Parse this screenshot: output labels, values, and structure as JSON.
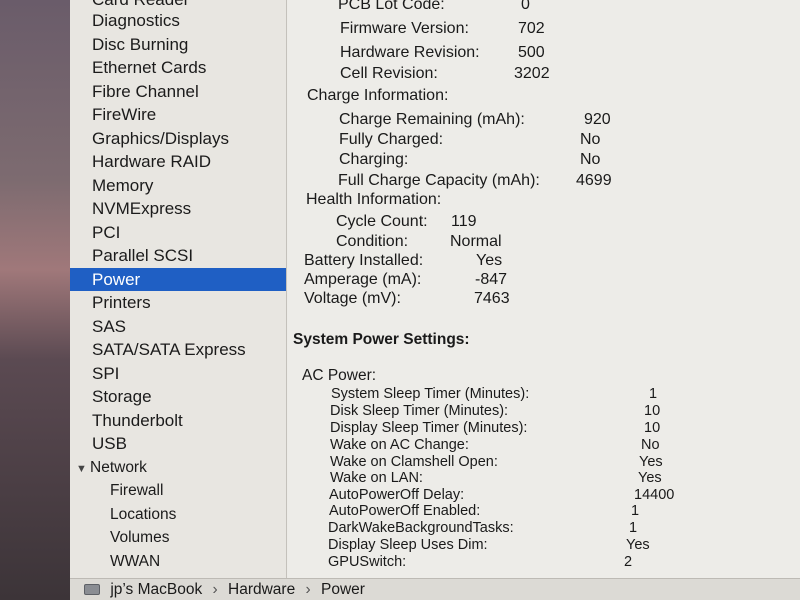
{
  "sidebar": {
    "top_partial": "Card Reader",
    "items": [
      {
        "label": "Diagnostics"
      },
      {
        "label": "Disc Burning"
      },
      {
        "label": "Ethernet Cards"
      },
      {
        "label": "Fibre Channel"
      },
      {
        "label": "FireWire"
      },
      {
        "label": "Graphics/Displays"
      },
      {
        "label": "Hardware RAID"
      },
      {
        "label": "Memory"
      },
      {
        "label": "NVMExpress"
      },
      {
        "label": "PCI"
      },
      {
        "label": "Parallel SCSI"
      },
      {
        "label": "Power",
        "selected": true
      },
      {
        "label": "Printers"
      },
      {
        "label": "SAS"
      },
      {
        "label": "SATA/SATA Express"
      },
      {
        "label": "SPI"
      },
      {
        "label": "Storage"
      },
      {
        "label": "Thunderbolt"
      },
      {
        "label": "USB"
      }
    ],
    "network_group": {
      "label": "Network",
      "items": [
        {
          "label": "Firewall"
        },
        {
          "label": "Locations"
        },
        {
          "label": "Volumes"
        },
        {
          "label": "WWAN"
        }
      ]
    }
  },
  "content": {
    "battery_model_rows": [
      {
        "key": "PCB Lot Code:",
        "value": "0"
      },
      {
        "key": "Firmware Version:",
        "value": "702"
      },
      {
        "key": "Hardware Revision:",
        "value": "500"
      },
      {
        "key": "Cell Revision:",
        "value": "3202"
      }
    ],
    "charge_info": {
      "heading": "Charge Information:",
      "rows": [
        {
          "key": "Charge Remaining (mAh):",
          "value": "920"
        },
        {
          "key": "Fully Charged:",
          "value": "No"
        },
        {
          "key": "Charging:",
          "value": "No"
        },
        {
          "key": "Full Charge Capacity (mAh):",
          "value": "4699"
        }
      ]
    },
    "health_info": {
      "heading": "Health Information:",
      "rows": [
        {
          "key": "Cycle Count:",
          "value": "119"
        },
        {
          "key": "Condition:",
          "value": "Normal"
        }
      ]
    },
    "battery_rows": [
      {
        "key": "Battery Installed:",
        "value": "Yes"
      },
      {
        "key": "Amperage (mA):",
        "value": "-847"
      },
      {
        "key": "Voltage (mV):",
        "value": "7463"
      }
    ],
    "system_power_heading": "System Power Settings:",
    "ac_power": {
      "heading": "AC Power:",
      "rows": [
        {
          "key": "System Sleep Timer (Minutes):",
          "value": "1"
        },
        {
          "key": "Disk Sleep Timer (Minutes):",
          "value": "10"
        },
        {
          "key": "Display Sleep Timer (Minutes):",
          "value": "10"
        },
        {
          "key": "Wake on AC Change:",
          "value": "No"
        },
        {
          "key": "Wake on Clamshell Open:",
          "value": "Yes"
        },
        {
          "key": "Wake on LAN:",
          "value": "Yes"
        },
        {
          "key": "AutoPowerOff Delay:",
          "value": "14400"
        },
        {
          "key": "AutoPowerOff Enabled:",
          "value": "1"
        },
        {
          "key": "DarkWakeBackgroundTasks:",
          "value": "1"
        },
        {
          "key": "Display Sleep Uses Dim:",
          "value": "Yes"
        },
        {
          "key": "GPUSwitch:",
          "value": "2"
        }
      ]
    }
  },
  "pathbar": {
    "computer": "jp’s MacBook",
    "category": "Hardware",
    "item": "Power",
    "separator": "›"
  },
  "colors": {
    "selection": "#1f5fc4",
    "window_bg": "#ecebe7"
  }
}
